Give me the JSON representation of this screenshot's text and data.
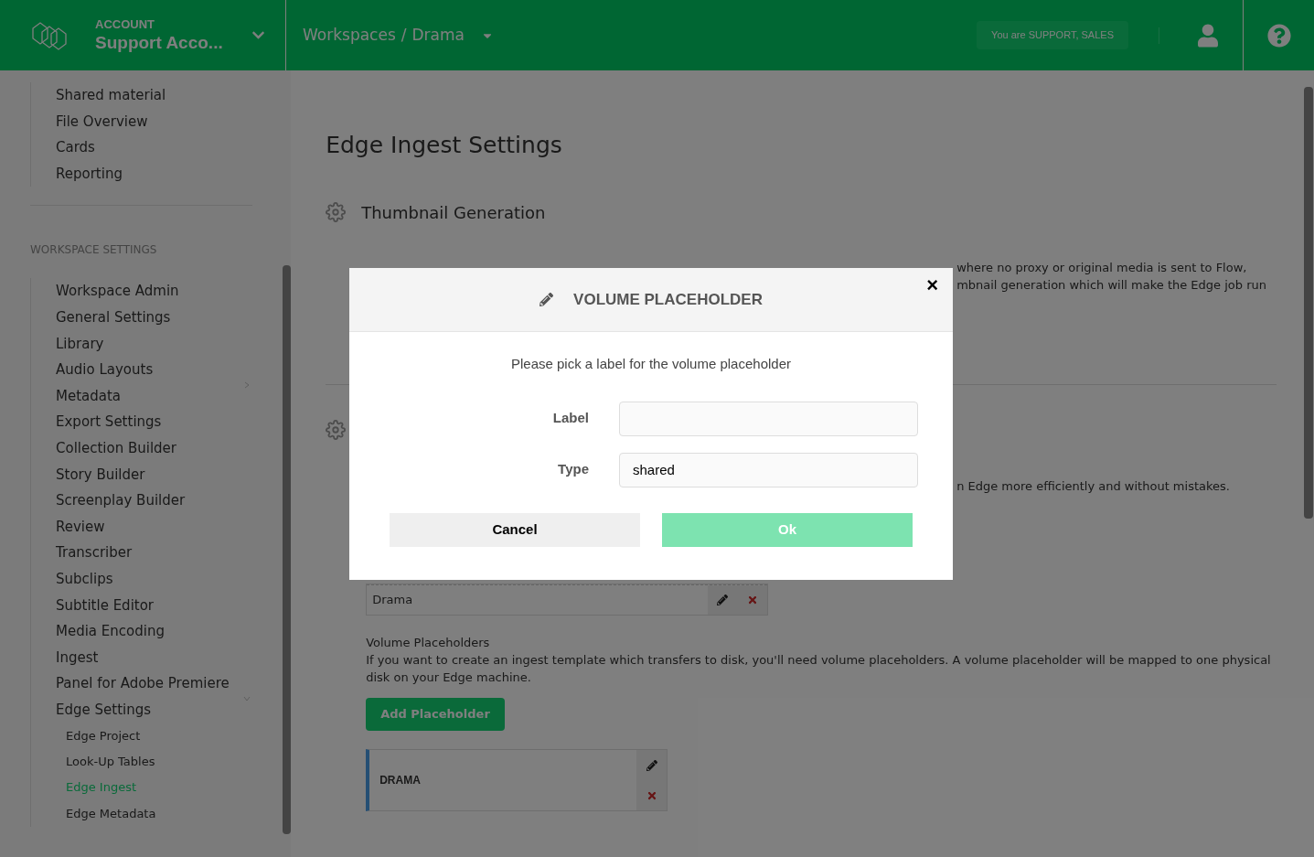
{
  "header": {
    "account_label": "ACCOUNT",
    "account_name": "Support Acco...",
    "breadcrumb": [
      "Workspaces",
      "Drama"
    ],
    "breadcrumb_separator": "/",
    "role_badge": "You are SUPPORT, SALES"
  },
  "sidebar": {
    "nav_items": [
      {
        "label": "Shared material"
      },
      {
        "label": "File Overview"
      },
      {
        "label": "Cards"
      },
      {
        "label": "Reporting"
      }
    ],
    "section_title": "WORKSPACE SETTINGS",
    "settings_items": [
      {
        "label": "Workspace Admin"
      },
      {
        "label": "General Settings"
      },
      {
        "label": "Library"
      },
      {
        "label": "Audio Layouts"
      },
      {
        "label": "Metadata",
        "expanded": false
      },
      {
        "label": "Export Settings"
      },
      {
        "label": "Collection Builder"
      },
      {
        "label": "Story Builder"
      },
      {
        "label": "Screenplay Builder"
      },
      {
        "label": "Review"
      },
      {
        "label": "Transcriber"
      },
      {
        "label": "Subclips"
      },
      {
        "label": "Subtitle Editor"
      },
      {
        "label": "Media Encoding"
      },
      {
        "label": "Ingest"
      },
      {
        "label": "Panel for Adobe Premiere"
      },
      {
        "label": "Edge Settings",
        "expanded": true,
        "children": [
          {
            "label": "Edge Project",
            "selected": false
          },
          {
            "label": "Look-Up Tables",
            "selected": false
          },
          {
            "label": "Edge Ingest",
            "selected": true
          },
          {
            "label": "Edge Metadata",
            "selected": false
          }
        ]
      }
    ]
  },
  "main": {
    "title": "Edge Ingest Settings",
    "thumbnail_heading": "Thumbnail Generation",
    "thumbnail_text_fragments": [
      "where no proxy or original media is sent to Flow,",
      "mbnail generation which will make the Edge job run"
    ],
    "second_section_fragment": "n Edge more efficiently and without mistakes.",
    "table_rows": [
      {
        "name": "Drama"
      }
    ],
    "volume_heading": "Volume Placeholders",
    "volume_text": "If you want to create an ingest template which transfers to disk, you'll need volume placeholders. A volume placeholder will be mapped to one physical disk on your Edge machine.",
    "add_button": "Add Placeholder",
    "placeholders": [
      {
        "name": "DRAMA"
      }
    ]
  },
  "modal": {
    "title": "VOLUME PLACEHOLDER",
    "close": "×",
    "prompt": "Please pick a label for the volume placeholder",
    "fields": [
      {
        "label": "Label"
      },
      {
        "label": "Type",
        "value": "shared"
      }
    ],
    "cancel": "Cancel",
    "ok": "Ok"
  }
}
